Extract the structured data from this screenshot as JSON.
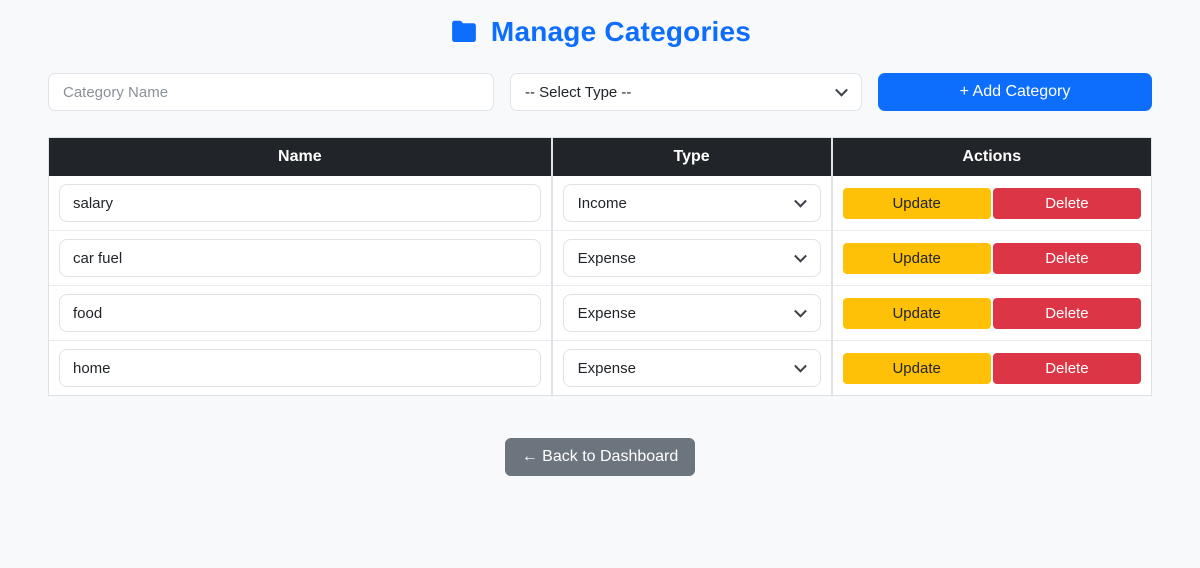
{
  "title": {
    "text": "Manage Categories",
    "icon": "folder-icon"
  },
  "colors": {
    "accent": "#0d6efd",
    "header_bg": "#212529",
    "update": "#ffc107",
    "delete": "#dc3545",
    "back": "#6c757d",
    "page_bg": "#f8f9fa"
  },
  "form": {
    "name_placeholder": "Category Name",
    "type_selected": "-- Select Type --",
    "add_label": "+ Add Category"
  },
  "table": {
    "headers": [
      "Name",
      "Type",
      "Actions"
    ],
    "action_labels": {
      "update": "Update",
      "delete": "Delete"
    },
    "rows": [
      {
        "name": "salary",
        "type": "Income"
      },
      {
        "name": "car fuel",
        "type": "Expense"
      },
      {
        "name": "food",
        "type": "Expense"
      },
      {
        "name": "home",
        "type": "Expense"
      }
    ]
  },
  "footer": {
    "back_label": "← Back to Dashboard"
  }
}
